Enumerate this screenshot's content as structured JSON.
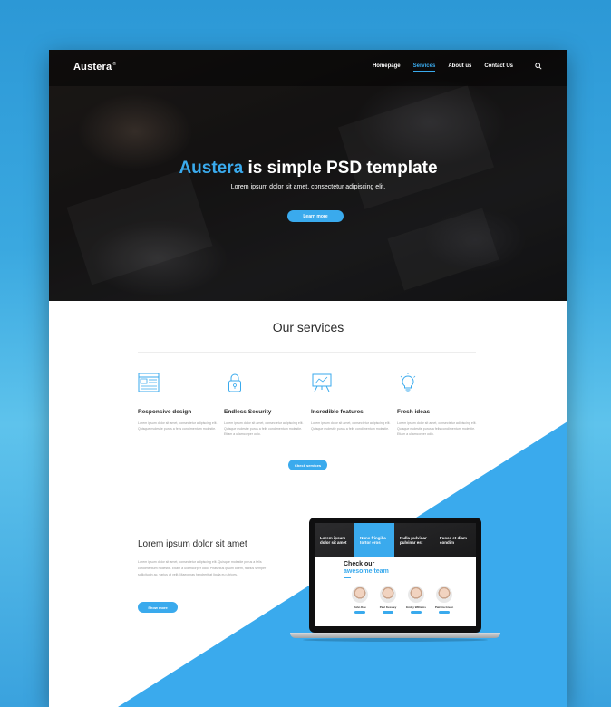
{
  "nav": {
    "logo": "Austera",
    "logo_mark": "®",
    "links": [
      "Homepage",
      "Services",
      "About us",
      "Contact Us"
    ],
    "active": "Services"
  },
  "hero": {
    "title_accent": "Austera",
    "title_rest": " is simple PSD template",
    "subtitle": "Lorem ipsum dolor sit amet, consectetur adipiscing elit.",
    "button": "Learn more"
  },
  "services": {
    "title": "Our services",
    "items": [
      {
        "icon": "browser-window-icon",
        "title": "Responsive design",
        "text": "Lorem ipsum dolor sit amet, consectetur adipiscing elit. Quisque molestie purus a felis condimentum molestie."
      },
      {
        "icon": "padlock-icon",
        "title": "Endless Security",
        "text": "Lorem ipsum dolor sit amet, consectetur adipiscing elit. Quisque molestie purus a felis condimentum molestie. Etiam a ullamcorper odio."
      },
      {
        "icon": "presentation-board-icon",
        "title": "Incredible features",
        "text": "Lorem ipsum dolor sit amet, consectetur adipiscing elit. Quisque molestie purus a felis condimentum molestie."
      },
      {
        "icon": "lightbulb-icon",
        "title": "Fresh ideas",
        "text": "Lorem ipsum dolor sit amet, consectetur adipiscing elit. Quisque molestie purus a felis condimentum molestie. Etiam a ullamcorper odio."
      }
    ],
    "button": "Check services"
  },
  "about": {
    "title": "Lorem ipsum dolor sit amet",
    "text": "Lorem ipsum dolor sit amet, consectetur adipiscing elit. Quisque molestie purus a felis condimentum molestie. Etiam a ullamcorper odio. Phasellus ipsum lorem, finibus semper sollicitudin ac, varius ut velit. Maecenas hendrerit at ligula eu ultrices.",
    "button": "Show more"
  },
  "laptop": {
    "columns": [
      "Lorem ipsum dolor sit amet",
      "Nunc fringilla tortor eros",
      "Nulla pulvinar pulvinar est",
      "Fusce et diam condim"
    ],
    "check_title": "Check our",
    "check_accent": "awesome team",
    "team": [
      "John Doe",
      "Paul Kessley",
      "Emilly Williams",
      "Patricia Green"
    ]
  },
  "colors": {
    "accent": "#3aaaed",
    "background": "#2c98d6"
  }
}
